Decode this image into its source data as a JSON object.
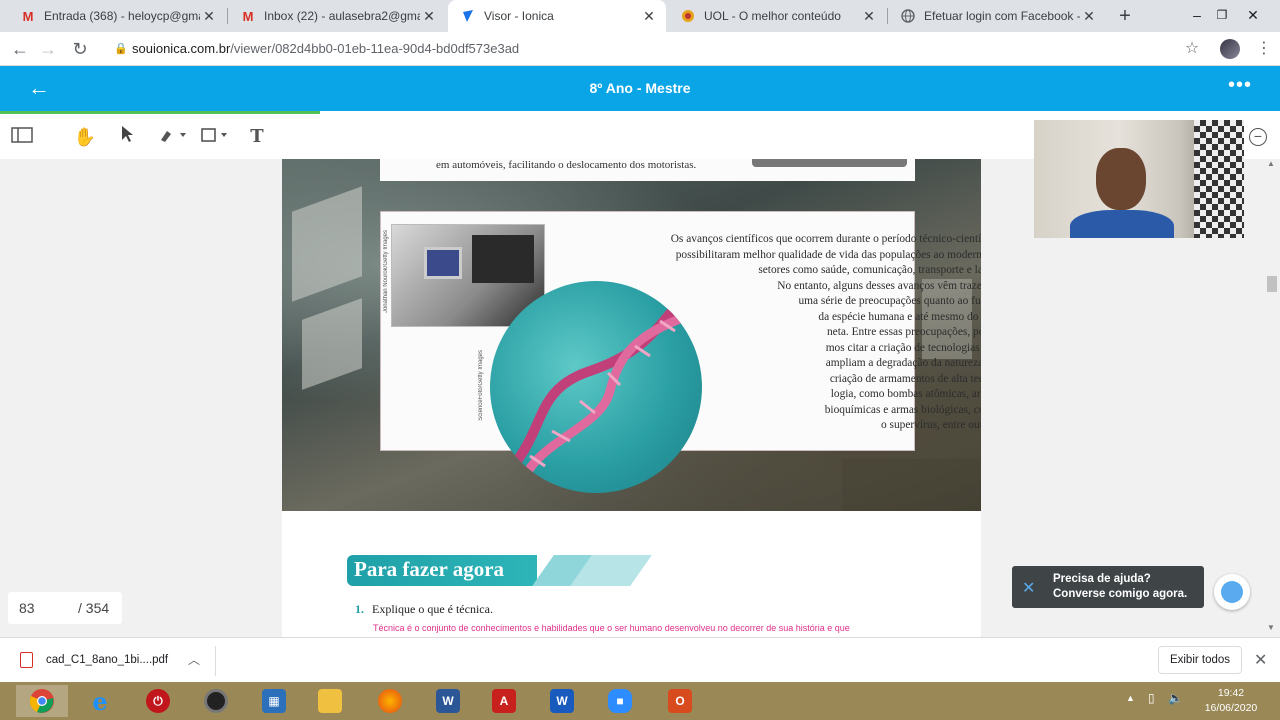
{
  "browser": {
    "tabs": [
      {
        "title": "Entrada (368) - heloycp@gmail",
        "icon": "gmail-icon",
        "active": false
      },
      {
        "title": "Inbox (22) - aulasebra2@gmail",
        "icon": "gmail-icon",
        "active": false
      },
      {
        "title": "Visor - Ionica",
        "icon": "ionica-icon",
        "active": true
      },
      {
        "title": "UOL - O melhor conteúdo",
        "icon": "uol-icon",
        "active": false
      },
      {
        "title": "Efetuar login com Facebook - Z",
        "icon": "globe-icon",
        "active": false
      }
    ],
    "url_host": "souionica.com.br",
    "url_path": "/viewer/082d4bb0-01eb-11ea-90d4-bd0df573e3ad"
  },
  "app": {
    "title": "8º Ano - Mestre"
  },
  "document": {
    "top_caption": "em automóveis, facilitando o deslocamento dos motoristas.",
    "body_lines": [
      "Os avanços científicos que ocorrem durante o período técnico-científico",
      "possibilitaram melhor qualidade de vida das populações ao modernizar",
      "setores como saúde, comunicação, transporte e lazer.",
      "No entanto, alguns desses avanços vêm trazendo",
      "uma série de preocupações quanto ao futuro",
      "da espécie humana e até mesmo do pla-",
      "neta. Entre essas preocupações, pode-",
      "mos citar a criação de tecnologias que",
      "ampliam a degradação da natureza e a",
      "criação de armamentos de alta tecno-",
      "logia, como bombas atômicas, armas",
      "bioquímicas e armas biológicas, como",
      "o supervírus, entre outras."
    ],
    "credit_1": "Jonathan Nourok/Getty Images",
    "credit_2": "ScienceFoto/Getty Images",
    "section_title": "Para fazer agora",
    "question_number": "1.",
    "question_text": "Explique o que é técnica.",
    "answer_text": "Técnica é o conjunto de conhecimentos e habilidades que o ser humano desenvolveu no decorrer de sua história e que"
  },
  "pager": {
    "current": "83",
    "total": "/ 354"
  },
  "help_widget": {
    "line1": "Precisa de ajuda?",
    "line2": "Converse comigo agora."
  },
  "downloads": {
    "file": "cad_C1_8ano_1bi....pdf",
    "show_all": "Exibir todos"
  },
  "taskbar": {
    "apps": [
      "chrome-icon",
      "ie-icon",
      "power-icon",
      "camera-icon",
      "calculator-icon",
      "folder-icon",
      "firefox-icon",
      "word-icon",
      "acrobat-icon",
      "word2-icon",
      "zoom-icon",
      "office-icon"
    ],
    "time": "19:42",
    "date": "16/06/2020"
  },
  "colors": {
    "header": "#0aa5e6",
    "progress": "#53c153",
    "accent_teal": "#1fa0a8",
    "answer_pink": "#e0308a"
  }
}
